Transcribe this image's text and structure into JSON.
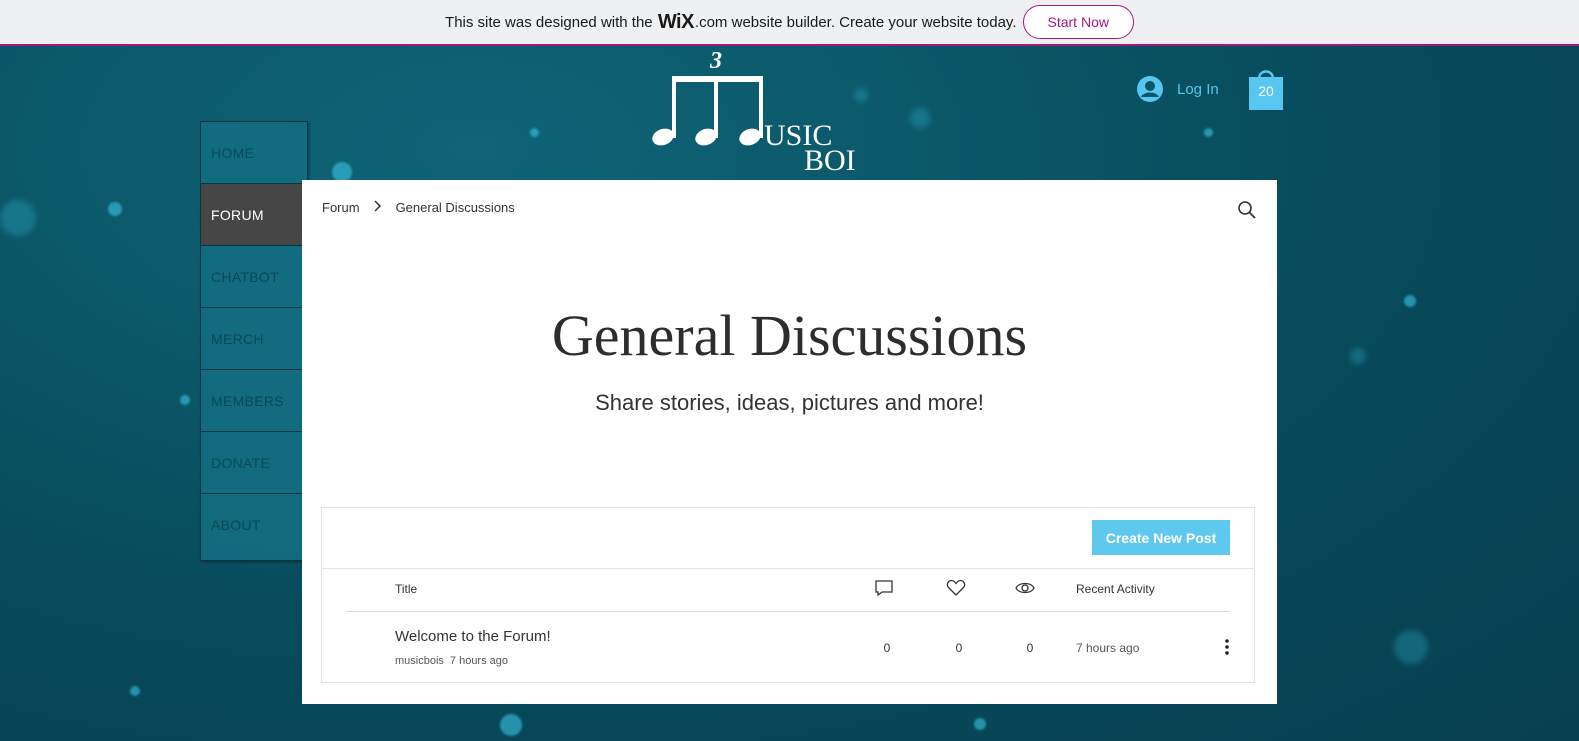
{
  "banner": {
    "text_before": "This site was designed with the",
    "wix": "WiX",
    "dotcom": ".com",
    "text_after": "website builder. Create your website today.",
    "cta": "Start Now"
  },
  "logo": {
    "triplet": "3",
    "line1": "USIC",
    "line2": "BOI"
  },
  "header": {
    "login_label": "Log In",
    "cart_count": "20"
  },
  "nav": {
    "items": [
      {
        "label": "HOME"
      },
      {
        "label": "FORUM"
      },
      {
        "label": "CHATBOT"
      },
      {
        "label": "MERCH"
      },
      {
        "label": "MEMBERS"
      },
      {
        "label": "DONATE"
      },
      {
        "label": "ABOUT"
      }
    ],
    "active": "FORUM"
  },
  "breadcrumb": {
    "root": "Forum",
    "current": "General Discussions"
  },
  "category": {
    "title": "General Discussions",
    "subtitle": "Share stories, ideas, pictures and more!"
  },
  "posts": {
    "create_label": "Create New Post",
    "columns": {
      "title": "Title",
      "recent": "Recent Activity"
    },
    "rows": [
      {
        "title": "Welcome to the Forum!",
        "author": "musicbois",
        "time": "7 hours ago",
        "comments": "0",
        "likes": "0",
        "views": "0",
        "recent": "7 hours ago"
      }
    ]
  },
  "colors": {
    "brand_magenta": "#a3197f",
    "accent_blue": "#5ec8ee",
    "nav_active": "#464646"
  }
}
